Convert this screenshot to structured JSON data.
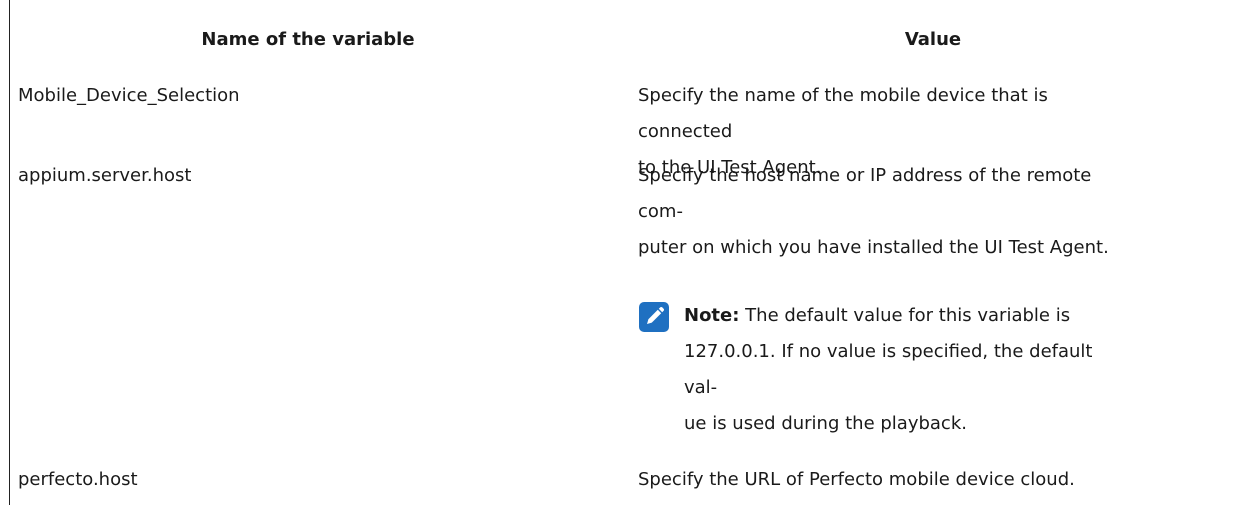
{
  "table": {
    "headers": {
      "name": "Name of the variable",
      "value": "Value"
    },
    "rows": [
      {
        "name": "Mobile_Device_Selection",
        "value_lines": [
          "Specify the name of the mobile device that is connected",
          "to the UI Test Agent."
        ]
      },
      {
        "name": "appium.server.host",
        "value_lines": [
          "Specify the host name or IP address of the remote com-",
          "puter on which you have installed the UI Test Agent."
        ],
        "note": {
          "label": "Note:",
          "lines": [
            " The default value for this variable is",
            "127.0.0.1. If no value is specified, the default val-",
            "ue is used during the playback."
          ]
        }
      },
      {
        "name": "perfecto.host",
        "value_lines": [
          "Specify the URL of Perfecto mobile device cloud."
        ]
      }
    ]
  },
  "icons": {
    "note": "note-pencil-icon"
  },
  "colors": {
    "note_icon": "#1f70c1",
    "text": "#1a1a1a"
  }
}
